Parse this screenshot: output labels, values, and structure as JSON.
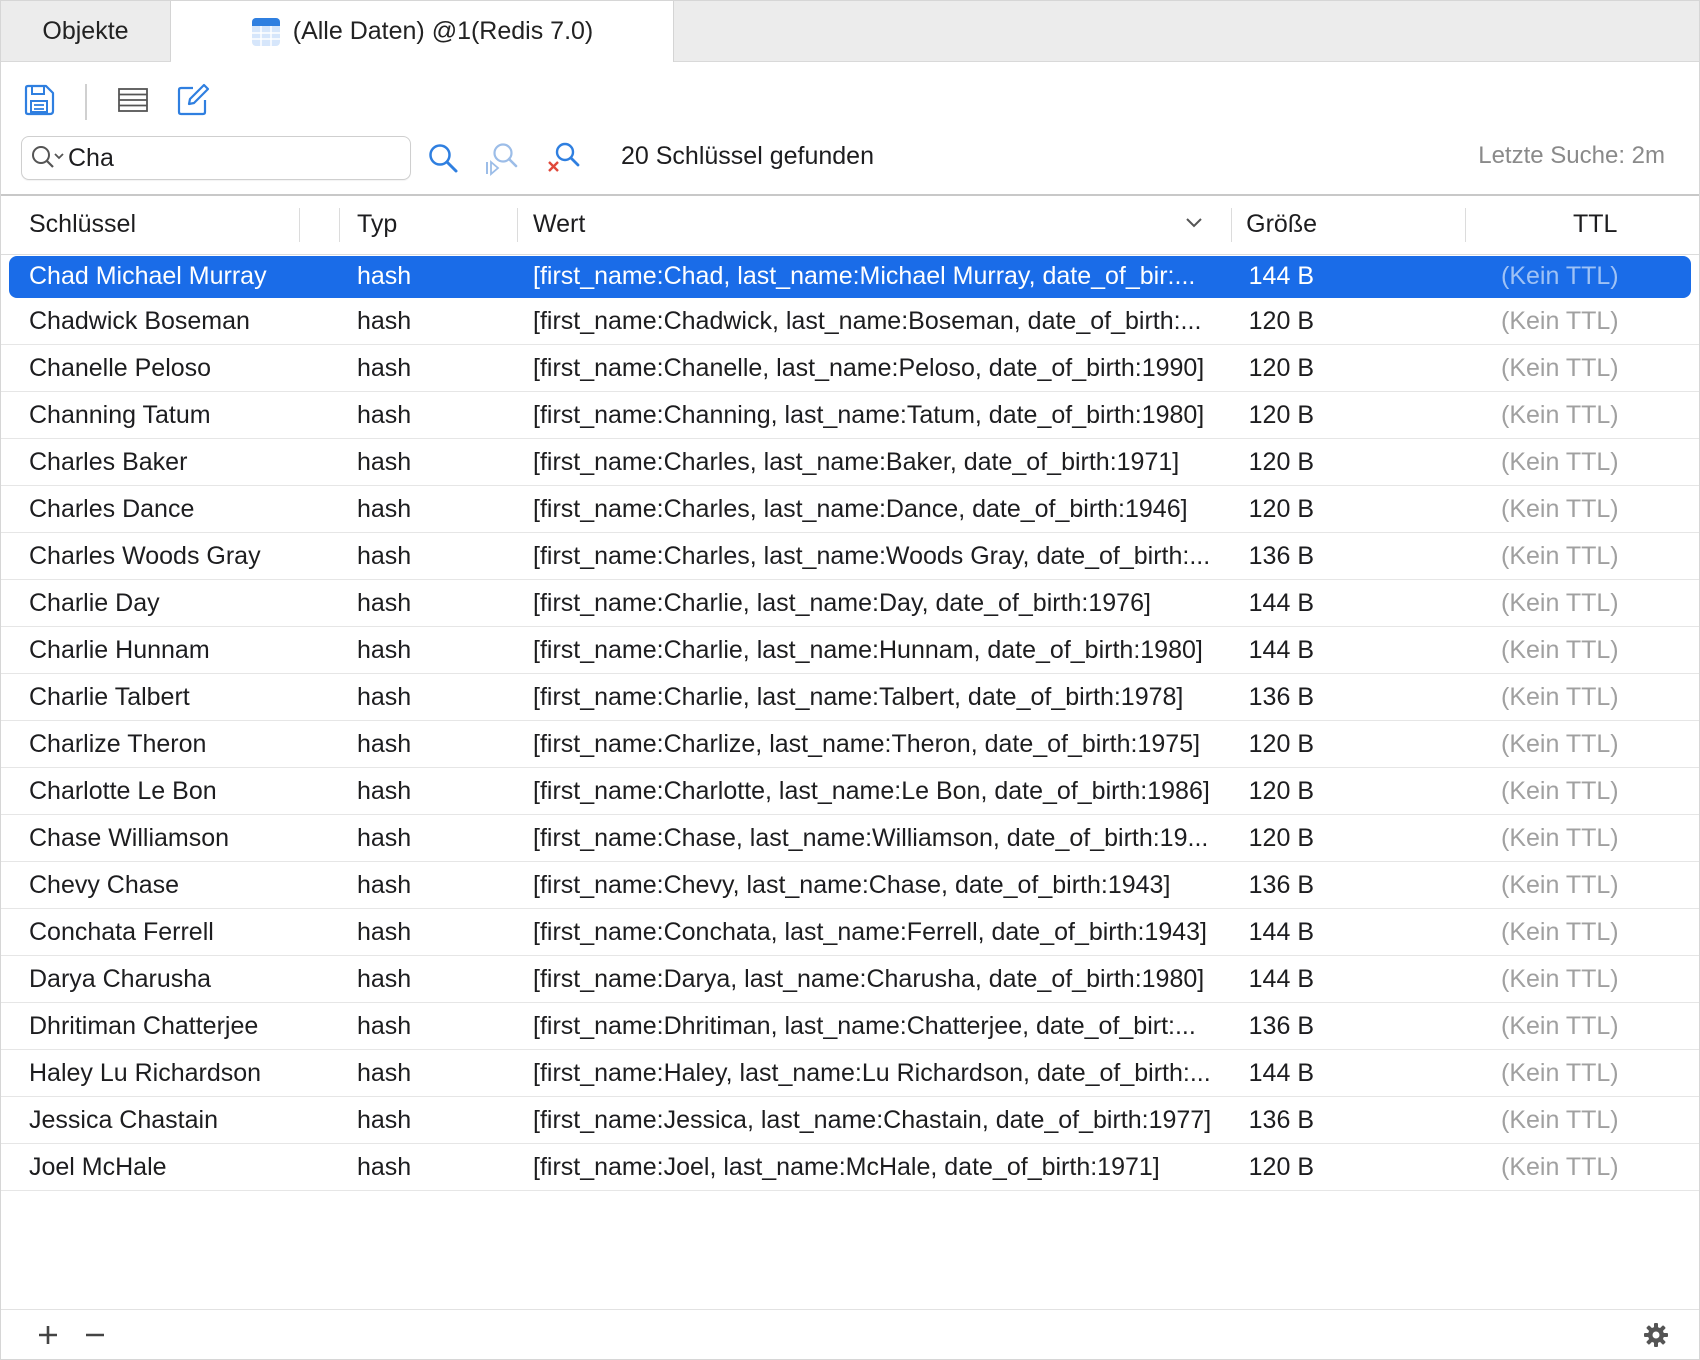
{
  "tabs": {
    "objects_label": "Objekte",
    "data_label": "(Alle Daten) @1(Redis 7.0)"
  },
  "search": {
    "value": "Cha",
    "result_text": "20 Schlüssel gefunden",
    "last_search": "Letzte Suche: 2m"
  },
  "columns": {
    "key": "Schlüssel",
    "type": "Typ",
    "value": "Wert",
    "size": "Größe",
    "ttl": "TTL"
  },
  "rows": [
    {
      "key": "Chad Michael Murray",
      "type": "hash",
      "value": "[first_name:Chad, last_name:Michael Murray, date_of_bir:...",
      "size": "144 B",
      "ttl": "(Kein TTL)"
    },
    {
      "key": "Chadwick Boseman",
      "type": "hash",
      "value": "[first_name:Chadwick, last_name:Boseman, date_of_birth:...",
      "size": "120 B",
      "ttl": "(Kein TTL)"
    },
    {
      "key": "Chanelle Peloso",
      "type": "hash",
      "value": "[first_name:Chanelle, last_name:Peloso, date_of_birth:1990]",
      "size": "120 B",
      "ttl": "(Kein TTL)"
    },
    {
      "key": "Channing Tatum",
      "type": "hash",
      "value": "[first_name:Channing, last_name:Tatum, date_of_birth:1980]",
      "size": "120 B",
      "ttl": "(Kein TTL)"
    },
    {
      "key": "Charles Baker",
      "type": "hash",
      "value": "[first_name:Charles, last_name:Baker, date_of_birth:1971]",
      "size": "120 B",
      "ttl": "(Kein TTL)"
    },
    {
      "key": "Charles Dance",
      "type": "hash",
      "value": "[first_name:Charles, last_name:Dance, date_of_birth:1946]",
      "size": "120 B",
      "ttl": "(Kein TTL)"
    },
    {
      "key": "Charles Woods Gray",
      "type": "hash",
      "value": "[first_name:Charles, last_name:Woods Gray, date_of_birth:...",
      "size": "136 B",
      "ttl": "(Kein TTL)"
    },
    {
      "key": "Charlie Day",
      "type": "hash",
      "value": "[first_name:Charlie, last_name:Day, date_of_birth:1976]",
      "size": "144 B",
      "ttl": "(Kein TTL)"
    },
    {
      "key": "Charlie Hunnam",
      "type": "hash",
      "value": "[first_name:Charlie, last_name:Hunnam, date_of_birth:1980]",
      "size": "144 B",
      "ttl": "(Kein TTL)"
    },
    {
      "key": "Charlie Talbert",
      "type": "hash",
      "value": "[first_name:Charlie, last_name:Talbert, date_of_birth:1978]",
      "size": "136 B",
      "ttl": "(Kein TTL)"
    },
    {
      "key": "Charlize Theron",
      "type": "hash",
      "value": "[first_name:Charlize, last_name:Theron, date_of_birth:1975]",
      "size": "120 B",
      "ttl": "(Kein TTL)"
    },
    {
      "key": "Charlotte Le Bon",
      "type": "hash",
      "value": "[first_name:Charlotte, last_name:Le Bon, date_of_birth:1986]",
      "size": "120 B",
      "ttl": "(Kein TTL)"
    },
    {
      "key": "Chase Williamson",
      "type": "hash",
      "value": "[first_name:Chase, last_name:Williamson, date_of_birth:19...",
      "size": "120 B",
      "ttl": "(Kein TTL)"
    },
    {
      "key": "Chevy Chase",
      "type": "hash",
      "value": "[first_name:Chevy, last_name:Chase, date_of_birth:1943]",
      "size": "136 B",
      "ttl": "(Kein TTL)"
    },
    {
      "key": "Conchata Ferrell",
      "type": "hash",
      "value": "[first_name:Conchata, last_name:Ferrell, date_of_birth:1943]",
      "size": "144 B",
      "ttl": "(Kein TTL)"
    },
    {
      "key": "Darya Charusha",
      "type": "hash",
      "value": "[first_name:Darya, last_name:Charusha, date_of_birth:1980]",
      "size": "144 B",
      "ttl": "(Kein TTL)"
    },
    {
      "key": "Dhritiman Chatterjee",
      "type": "hash",
      "value": "[first_name:Dhritiman, last_name:Chatterjee, date_of_birt:...",
      "size": "136 B",
      "ttl": "(Kein TTL)"
    },
    {
      "key": "Haley Lu Richardson",
      "type": "hash",
      "value": "[first_name:Haley, last_name:Lu Richardson, date_of_birth:...",
      "size": "144 B",
      "ttl": "(Kein TTL)"
    },
    {
      "key": "Jessica Chastain",
      "type": "hash",
      "value": "[first_name:Jessica, last_name:Chastain, date_of_birth:1977]",
      "size": "136 B",
      "ttl": "(Kein TTL)"
    },
    {
      "key": "Joel McHale",
      "type": "hash",
      "value": "[first_name:Joel, last_name:McHale, date_of_birth:1971]",
      "size": "120 B",
      "ttl": "(Kein TTL)"
    }
  ],
  "selected_row": 0,
  "icons": {
    "save": "save-icon",
    "list": "list-icon",
    "edit": "edit-icon",
    "search": "search-icon",
    "find_next": "find-next-icon",
    "clear_search": "clear-search-icon",
    "add": "plus-icon",
    "remove": "minus-icon",
    "settings": "gear-icon",
    "table": "table-icon"
  },
  "colors": {
    "accent": "#1a6ce8",
    "icon_blue": "#2f7fe0",
    "clear_red": "#e0483a",
    "muted_text": "#a0a0a0"
  }
}
